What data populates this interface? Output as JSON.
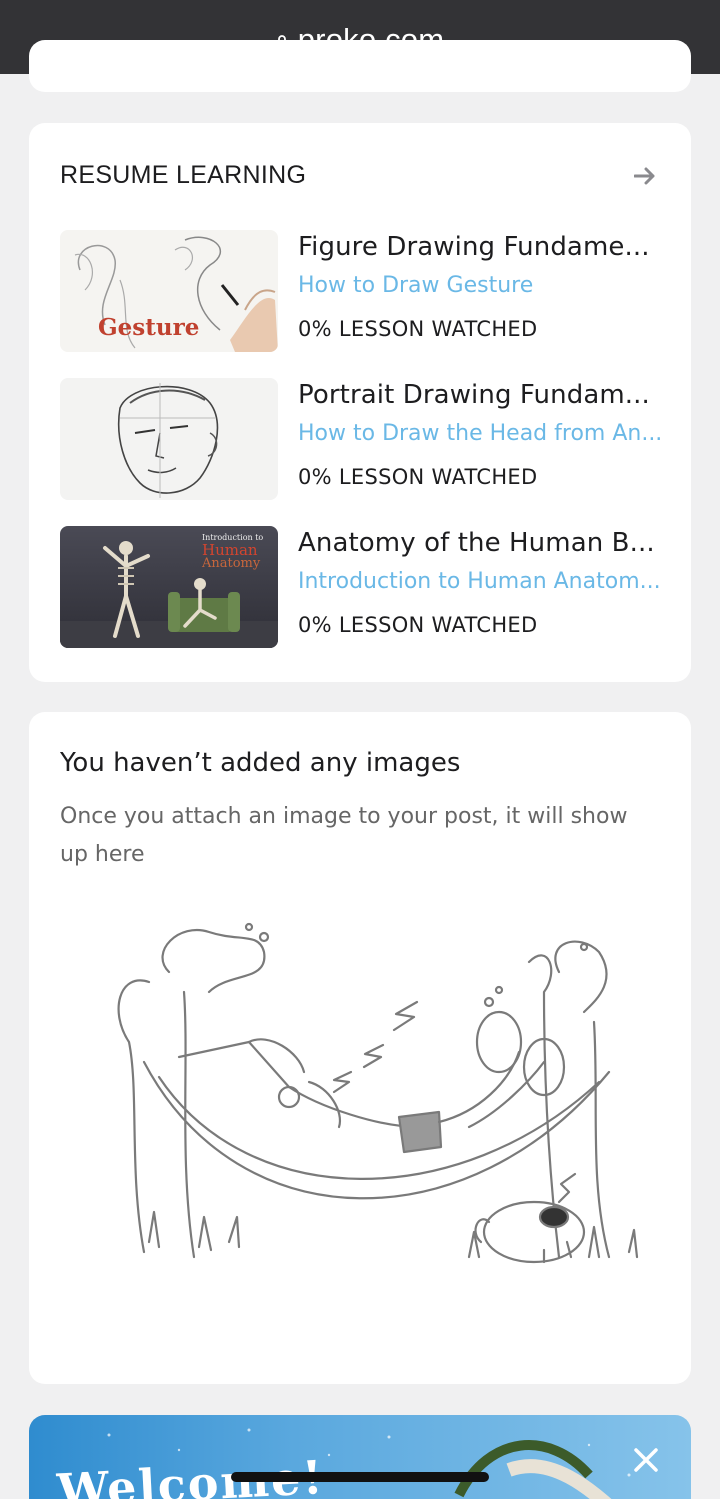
{
  "browser": {
    "url": "proko.com",
    "lock_icon": "lock-icon"
  },
  "resume": {
    "title": "RESUME LEARNING",
    "arrow_icon": "arrow-right-icon",
    "courses": [
      {
        "title": "Figure Drawing Fundame...",
        "lesson": "How to Draw Gesture",
        "progress": "0% LESSON WATCHED",
        "thumb_label": "Gesture"
      },
      {
        "title": "Portrait Drawing Fundam...",
        "lesson": "How to Draw the Head from An...",
        "progress": "0% LESSON WATCHED"
      },
      {
        "title": "Anatomy of the Human B...",
        "lesson": "Introduction to Human Anatom...",
        "progress": "0% LESSON WATCHED",
        "thumb_intro": "Introduction to",
        "thumb_title1": "Human",
        "thumb_title2": "Anatomy"
      }
    ]
  },
  "images_section": {
    "title": "You haven’t added any images",
    "description": "Once you attach an image to your post, it will show up here"
  },
  "welcome_banner": {
    "text": "Welcome!",
    "close_icon": "close-icon"
  },
  "colors": {
    "lesson_link": "#6ab8e6",
    "browser_bar": "#333336",
    "background": "#f0f0f1"
  }
}
